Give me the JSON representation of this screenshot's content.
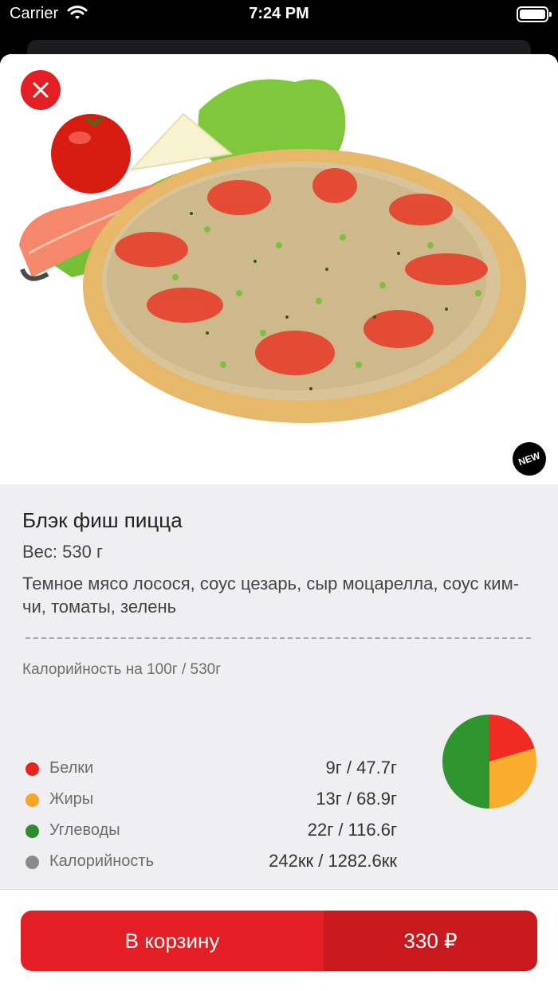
{
  "status_bar": {
    "carrier": "Carrier",
    "time": "7:24 PM"
  },
  "product": {
    "name": "Блэк фиш пицца",
    "weight": "Вес: 530 г",
    "description": "Темное мясо лосося, соус цезарь, сыр моцарелла, соус ким-чи, томаты, зелень",
    "badge": "NEW"
  },
  "nutrition": {
    "caption": "Калорийность на 100г / 530г",
    "rows": [
      {
        "label": "Белки",
        "value": "9г / 47.7г",
        "color": "#e8231f"
      },
      {
        "label": "Жиры",
        "value": "13г / 68.9г",
        "color": "#f6a623"
      },
      {
        "label": "Углеводы",
        "value": "22г / 116.6г",
        "color": "#2e8b2e"
      },
      {
        "label": "Калорийность",
        "value": "242кк / 1282.6кк",
        "color": "#8a8a8a"
      }
    ]
  },
  "chart_data": {
    "type": "pie",
    "categories": [
      "Белки",
      "Жиры",
      "Углеводы"
    ],
    "values": [
      9,
      13,
      22
    ],
    "colors": [
      "#ef2b24",
      "#f9ad2f",
      "#2f962f"
    ]
  },
  "footer": {
    "cart_label": "В корзину",
    "price": "330 ₽"
  },
  "icons": {
    "close": "close-icon",
    "wifi": "wifi-icon",
    "battery": "battery-icon"
  }
}
